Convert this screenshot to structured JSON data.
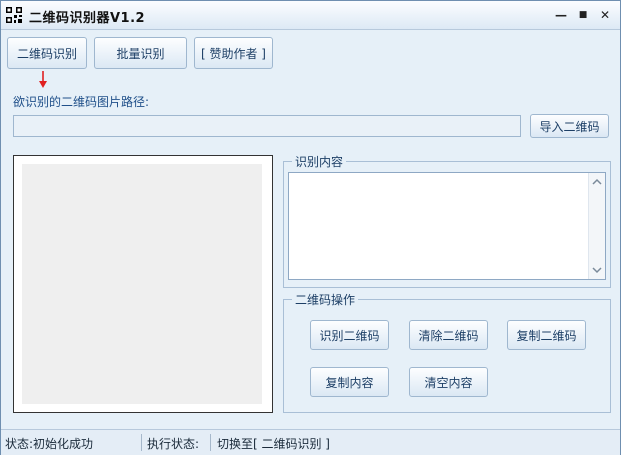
{
  "window": {
    "title": "二维码识别器V1.2"
  },
  "titlebar_buttons": {
    "minimize": "—",
    "maximize": "■",
    "close": "✕"
  },
  "toolbar": {
    "recognize_tab": "二维码识别",
    "batch_tab": "批量识别",
    "sponsor": "[ 赞助作者 ]"
  },
  "path": {
    "label": "欲识别的二维码图片路径:",
    "value": "",
    "import_button": "导入二维码"
  },
  "result_group": {
    "title": "识别内容",
    "content": ""
  },
  "ops_group": {
    "title": "二维码操作",
    "recognize": "识别二维码",
    "clear_qr": "清除二维码",
    "copy_qr": "复制二维码",
    "copy_content": "复制内容",
    "clear_content": "清空内容"
  },
  "status": {
    "state": "状态:初始化成功",
    "exec_label": "执行状态:",
    "exec_value": "切换至[ 二维码识别 ]"
  },
  "colors": {
    "accent_arrow": "#e02020",
    "label_blue": "#20508a",
    "window_bg": "#e6f0f8"
  },
  "icons": {
    "app": "qr-code-icon",
    "arrow": "red-down-arrow-icon"
  }
}
